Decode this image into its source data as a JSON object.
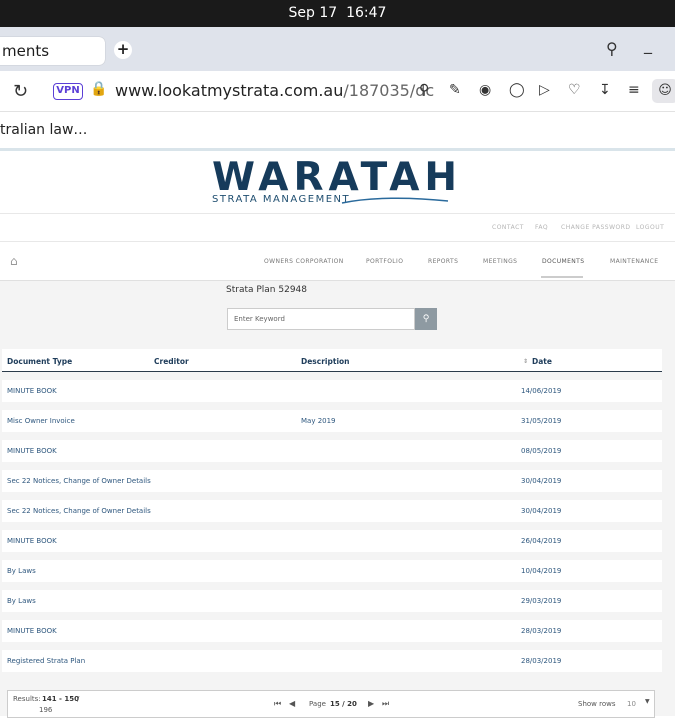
{
  "system": {
    "date": "Sep 17",
    "time": "16:47"
  },
  "browser": {
    "tab_title": "ments",
    "url_domain": "www.lookatmystrata.com.au",
    "url_rest": "/187035/dc",
    "vpn_label": "VPN",
    "bookmark_text": "tralian law…"
  },
  "site": {
    "logo_text": "WARATAH",
    "logo_subtitle": "STRATA MANAGEMENT",
    "top_links": [
      "CONTACT",
      "FAQ",
      "CHANGE PASSWORD",
      "LOGOUT"
    ],
    "nav": [
      "OWNERS CORPORATION",
      "PORTFOLIO",
      "REPORTS",
      "MEETINGS",
      "DOCUMENTS",
      "MAINTENANCE"
    ],
    "active_nav": "DOCUMENTS"
  },
  "main": {
    "plan_title": "Strata Plan 52948",
    "search_placeholder": "Enter Keyword",
    "columns": [
      "Document Type",
      "Creditor",
      "Description",
      "Date"
    ],
    "rows": [
      {
        "type": "MINUTE BOOK",
        "creditor": "",
        "description": "",
        "date": "14/06/2019"
      },
      {
        "type": "Misc Owner Invoice",
        "creditor": "",
        "description": "May 2019",
        "date": "31/05/2019"
      },
      {
        "type": "MINUTE BOOK",
        "creditor": "",
        "description": "",
        "date": "08/05/2019"
      },
      {
        "type": "Sec 22 Notices, Change of Owner Details",
        "creditor": "",
        "description": "",
        "date": "30/04/2019"
      },
      {
        "type": "Sec 22 Notices, Change of Owner Details",
        "creditor": "",
        "description": "",
        "date": "30/04/2019"
      },
      {
        "type": "MINUTE BOOK",
        "creditor": "",
        "description": "",
        "date": "26/04/2019"
      },
      {
        "type": "By Laws",
        "creditor": "",
        "description": "",
        "date": "10/04/2019"
      },
      {
        "type": "By Laws",
        "creditor": "",
        "description": "",
        "date": "29/03/2019"
      },
      {
        "type": "MINUTE BOOK",
        "creditor": "",
        "description": "",
        "date": "28/03/2019"
      },
      {
        "type": "Registered Strata Plan",
        "creditor": "",
        "description": "",
        "date": "28/03/2019"
      }
    ],
    "pager": {
      "results_label": "Results:",
      "results_range": "141 - 150",
      "results_total": "196",
      "page_label": "Page",
      "page_current": "15 / 20",
      "show_rows_label": "Show rows",
      "show_rows_value": "10"
    }
  },
  "colors": {
    "logo": "#163b5b",
    "link": "#2e577e",
    "vpn": "#5b3fd6"
  }
}
